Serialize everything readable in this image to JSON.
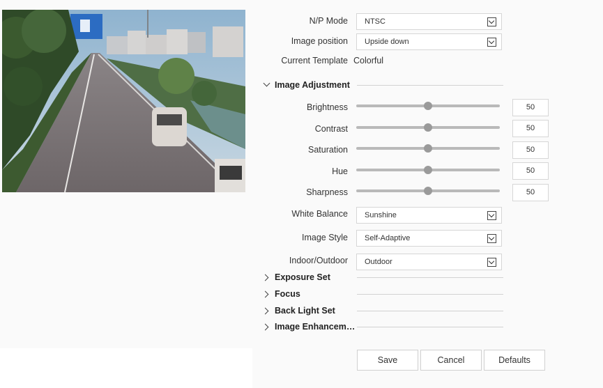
{
  "fields": {
    "np_mode": {
      "label": "N/P Mode",
      "value": "NTSC"
    },
    "image_position": {
      "label": "Image position",
      "value": "Upside down"
    },
    "current_template": {
      "label": "Current Template",
      "value": "Colorful"
    }
  },
  "sections": {
    "image_adjustment": "Image Adjustment",
    "exposure_set": "Exposure Set",
    "focus": "Focus",
    "back_light_set": "Back Light Set",
    "image_enhancement": "Image Enhancem…"
  },
  "sliders": [
    {
      "label": "Brightness",
      "value": "50",
      "fraction": 0.5
    },
    {
      "label": "Contrast",
      "value": "50",
      "fraction": 0.5
    },
    {
      "label": "Saturation",
      "value": "50",
      "fraction": 0.5
    },
    {
      "label": "Hue",
      "value": "50",
      "fraction": 0.5
    },
    {
      "label": "Sharpness",
      "value": "50",
      "fraction": 0.5
    }
  ],
  "selects": {
    "white_balance": {
      "label": "White Balance",
      "value": "Sunshine"
    },
    "image_style": {
      "label": "Image Style",
      "value": "Self-Adaptive"
    },
    "indoor_outdoor": {
      "label": "Indoor/Outdoor",
      "value": "Outdoor"
    }
  },
  "buttons": {
    "save": "Save",
    "cancel": "Cancel",
    "defaults": "Defaults"
  }
}
